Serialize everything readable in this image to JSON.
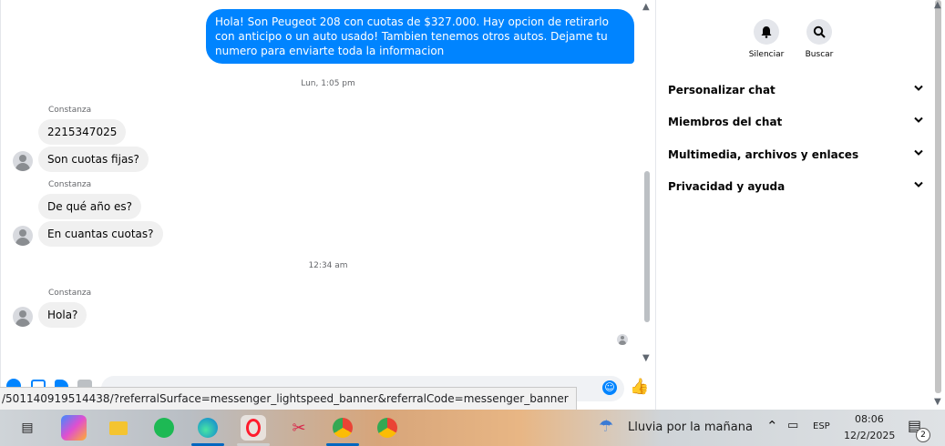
{
  "colors": {
    "messenger_blue": "#0084ff",
    "bubble_gray": "#f0f0f0",
    "meta_text": "#65676b"
  },
  "chat": {
    "outgoing_message": "Hola! Son Peugeot 208 con cuotas de $327.000. Hay opcion de retirarlo con anticipo o un auto usado! Tambien tenemos otros autos. Dejame tu numero para enviarte toda la informacion",
    "time_1": "Lun, 1:05 pm",
    "sender_1": "Constanza",
    "msg_1": "2215347025",
    "msg_2": "Son cuotas fijas?",
    "sender_2": "Constanza",
    "msg_3": "De qué año es?",
    "msg_4": "En cuantas cuotas?",
    "time_2": "12:34 am",
    "sender_3": "Constanza",
    "msg_5": "Hola?"
  },
  "composer": {
    "icons": [
      "plus-icon",
      "gallery-icon",
      "sticker-icon",
      "gif-icon",
      "emoji-icon",
      "like-icon"
    ]
  },
  "url_tooltip": "/501140919514438/?referralSurface=messenger_lightspeed_banner&referralCode=messenger_banner",
  "info_panel": {
    "mute_label": "Silenciar",
    "search_label": "Buscar",
    "sections": [
      {
        "label": "Personalizar chat"
      },
      {
        "label": "Miembros del chat"
      },
      {
        "label": "Multimedia, archivos y enlaces"
      },
      {
        "label": "Privacidad y ayuda"
      }
    ]
  },
  "taskbar": {
    "apps": [
      "task-view",
      "copilot",
      "file-explorer",
      "spotify",
      "edge",
      "opera",
      "snipping-tool",
      "chrome-profile",
      "chrome"
    ],
    "weather_text": "Lluvia por la mañana",
    "language": "ESP",
    "time": "08:06",
    "date": "12/2/2025",
    "notification_count": "2"
  }
}
